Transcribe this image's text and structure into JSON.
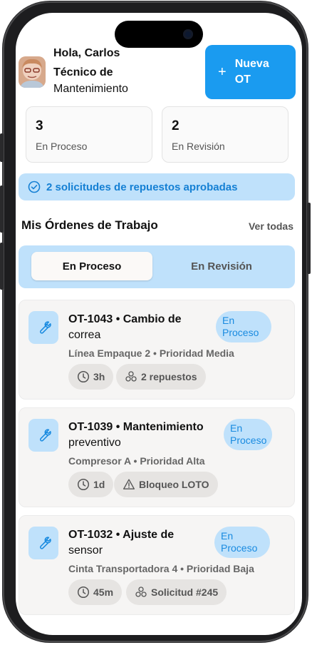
{
  "header": {
    "greeting": "Hola, Carlos",
    "role_line1": "Técnico de",
    "role_line2": "Mantenimiento",
    "new_button_icon": "+",
    "new_button_label": "Nueva OT"
  },
  "stats": [
    {
      "value": "3",
      "label": "En Proceso"
    },
    {
      "value": "2",
      "label": "En Revisión"
    }
  ],
  "notice": {
    "icon": "check-circle-icon",
    "text": "2 solicitudes de repuestos aprobadas"
  },
  "section": {
    "title": "Mis Órdenes de Trabajo",
    "see_all": "Ver todas"
  },
  "tabs": [
    {
      "label": "En Proceso",
      "active": true
    },
    {
      "label": "En Revisión",
      "active": false
    }
  ],
  "orders": [
    {
      "id": "OT-1043 • Cambio de",
      "title_rest": "correa",
      "status": "En Proceso",
      "meta": "Línea Empaque 2 • Prioridad Media",
      "chips": [
        {
          "icon": "clock-icon",
          "text": "3h"
        },
        {
          "icon": "parts-icon",
          "text": "2 repuestos"
        }
      ]
    },
    {
      "id": "OT-1039 • Mantenimiento",
      "title_rest": "preventivo",
      "status": "En Proceso",
      "meta": "Compresor A • Prioridad Alta",
      "chips": [
        {
          "icon": "clock-icon",
          "text": "1d"
        },
        {
          "icon": "warning-icon",
          "text": "Bloqueo LOTO"
        }
      ]
    },
    {
      "id": "OT-1032 • Ajuste de",
      "title_rest": "sensor",
      "status": "En Proceso",
      "meta": "Cinta Transportadora 4 • Prioridad Baja",
      "chips": [
        {
          "icon": "clock-icon",
          "text": "45m"
        },
        {
          "icon": "parts-icon",
          "text": "Solicitud #245"
        }
      ]
    }
  ],
  "colors": {
    "accent": "#1a9bf0",
    "accent_light": "#bfe1fb",
    "accent_text": "#1580d4"
  }
}
